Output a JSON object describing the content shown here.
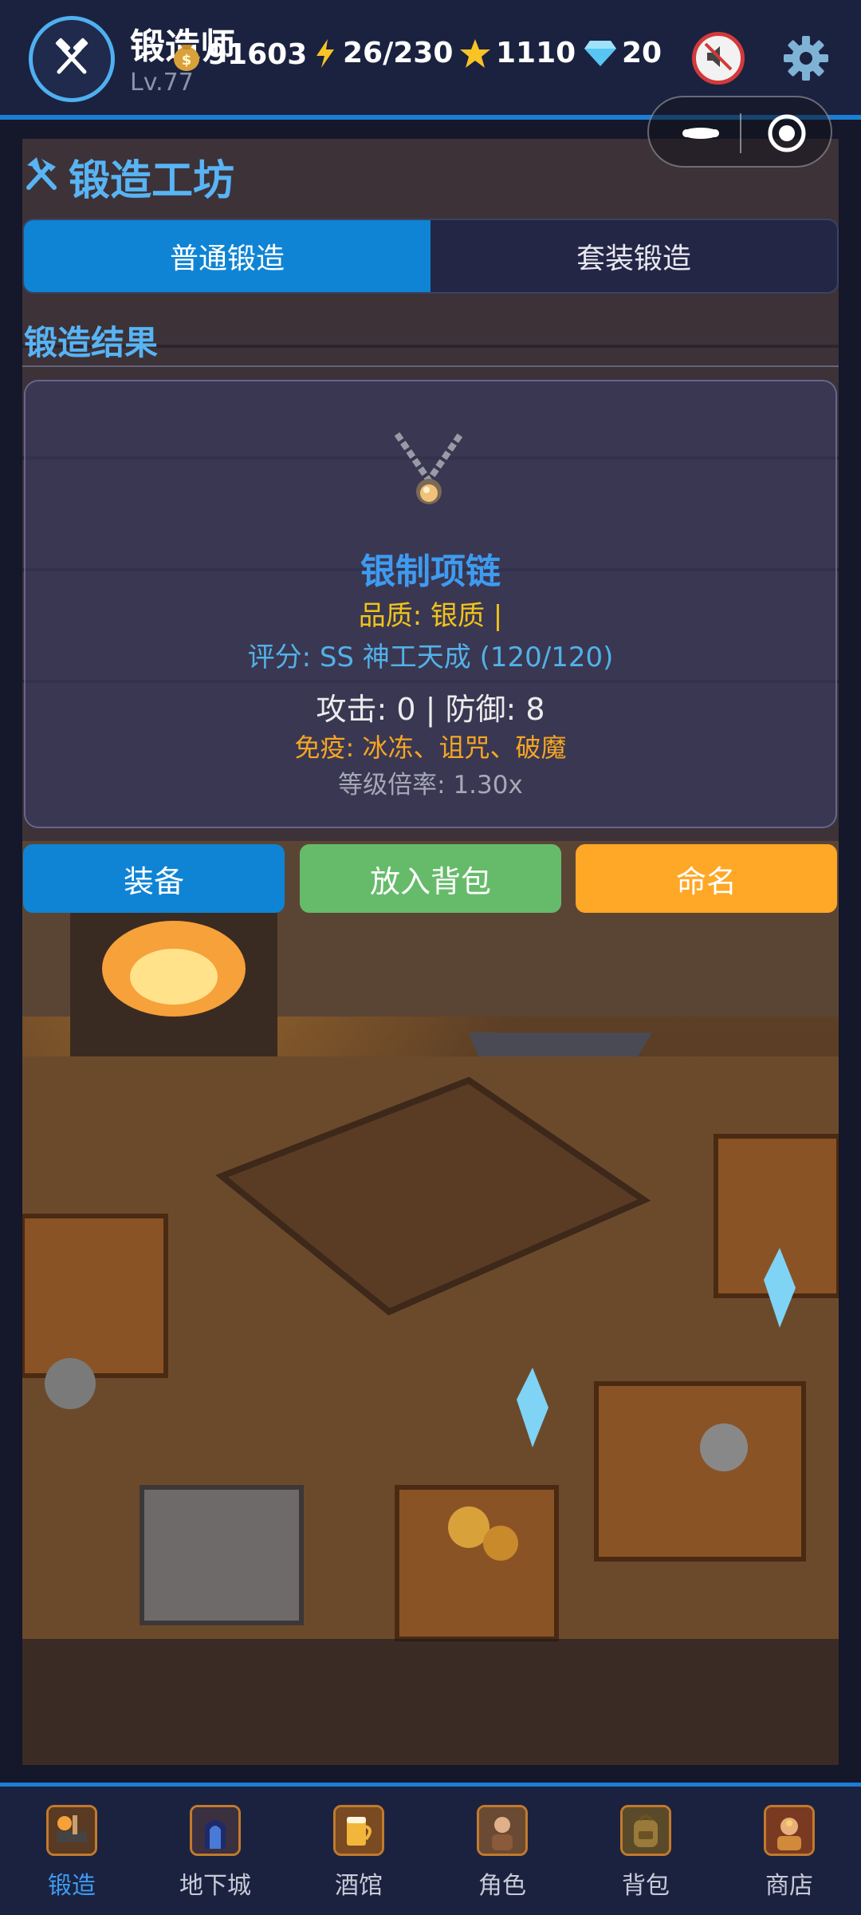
{
  "player": {
    "name": "锻造师",
    "level": "Lv.77",
    "gold": "91603",
    "energy": "26/230",
    "stars": "1110",
    "gems": "20"
  },
  "icons": {
    "avatar": "crossed-hammers-icon",
    "gold": "money-bag-icon",
    "energy": "lightning-icon",
    "stars": "star-icon",
    "gems": "diamond-icon",
    "mute": "sound-muted-icon",
    "settings": "gear-icon"
  },
  "workshop": {
    "title": "锻造工坊",
    "tabs": [
      {
        "label": "普通锻造",
        "active": true
      },
      {
        "label": "套装锻造",
        "active": false
      }
    ],
    "result_title": "锻造结果"
  },
  "result": {
    "item_name": "银制项链",
    "quality": "品质: 银质 |",
    "score": "评分: SS 神工天成 (120/120)",
    "stats": "攻击: 0 | 防御: 8",
    "immunity": "免疫: 冰冻、诅咒、破魔",
    "level_rate": "等级倍率: 1.30x"
  },
  "actions": {
    "equip": "装备",
    "store": "放入背包",
    "rename": "命名"
  },
  "nav": [
    {
      "label": "锻造",
      "icon": "forge-icon",
      "active": true
    },
    {
      "label": "地下城",
      "icon": "dungeon-icon",
      "active": false
    },
    {
      "label": "酒馆",
      "icon": "tavern-icon",
      "active": false
    },
    {
      "label": "角色",
      "icon": "character-icon",
      "active": false
    },
    {
      "label": "背包",
      "icon": "backpack-icon",
      "active": false
    },
    {
      "label": "商店",
      "icon": "shop-icon",
      "active": false
    }
  ],
  "colors": {
    "accent": "#0f84d4",
    "title_blue": "#58b4f4",
    "quality_gold": "#f0c419",
    "green_button": "#66bb6a",
    "orange_button": "#ffa726"
  }
}
